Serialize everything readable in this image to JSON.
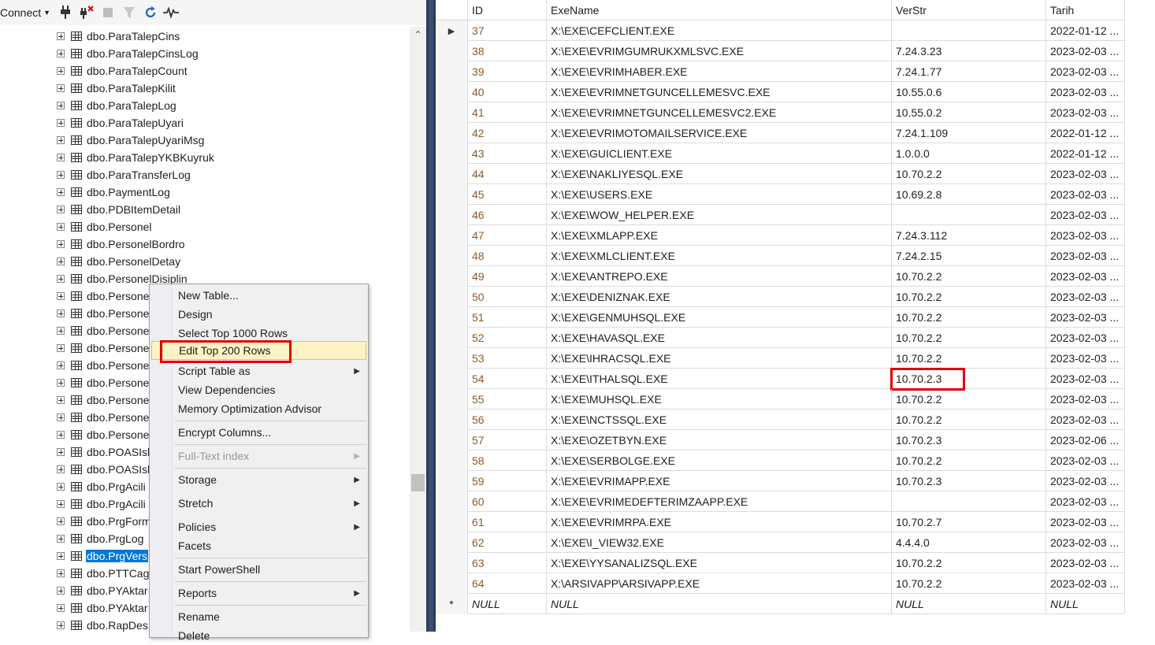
{
  "object_explorer": {
    "toolbar": {
      "connect_label": "Connect"
    },
    "items": [
      {
        "label": "dbo.ParaTalepCins"
      },
      {
        "label": "dbo.ParaTalepCinsLog"
      },
      {
        "label": "dbo.ParaTalepCount"
      },
      {
        "label": "dbo.ParaTalepKilit"
      },
      {
        "label": "dbo.ParaTalepLog"
      },
      {
        "label": "dbo.ParaTalepUyari"
      },
      {
        "label": "dbo.ParaTalepUyariMsg"
      },
      {
        "label": "dbo.ParaTalepYKBKuyruk"
      },
      {
        "label": "dbo.ParaTransferLog"
      },
      {
        "label": "dbo.PaymentLog"
      },
      {
        "label": "dbo.PDBItemDetail"
      },
      {
        "label": "dbo.Personel"
      },
      {
        "label": "dbo.PersonelBordro"
      },
      {
        "label": "dbo.PersonelDetay"
      },
      {
        "label": "dbo.PersonelDisiplin"
      },
      {
        "label": "dbo.Persone"
      },
      {
        "label": "dbo.Persone"
      },
      {
        "label": "dbo.Persone"
      },
      {
        "label": "dbo.Persone"
      },
      {
        "label": "dbo.Persone"
      },
      {
        "label": "dbo.Persone"
      },
      {
        "label": "dbo.Persone"
      },
      {
        "label": "dbo.Persone"
      },
      {
        "label": "dbo.Persone"
      },
      {
        "label": "dbo.POASIsl"
      },
      {
        "label": "dbo.POASIsl"
      },
      {
        "label": "dbo.PrgAcili"
      },
      {
        "label": "dbo.PrgAcili"
      },
      {
        "label": "dbo.PrgForm"
      },
      {
        "label": "dbo.PrgLog"
      },
      {
        "label": "dbo.PrgVers",
        "selected": true
      },
      {
        "label": "dbo.PTTCag"
      },
      {
        "label": "dbo.PYAktar"
      },
      {
        "label": "dbo.PYAktar"
      },
      {
        "label": "dbo.RapDes"
      }
    ]
  },
  "context_menu": {
    "items": [
      {
        "label": "New Table..."
      },
      {
        "label": "Design"
      },
      {
        "label": "Select Top 1000 Rows"
      },
      {
        "label": "Edit Top 200 Rows",
        "hovered": true
      },
      {
        "label": "Script Table as",
        "submenu": true
      },
      {
        "label": "View Dependencies"
      },
      {
        "label": "Memory Optimization Advisor"
      },
      {
        "label": "Encrypt Columns..."
      },
      {
        "label": "Full-Text index",
        "submenu": true,
        "disabled": true
      },
      {
        "label": "Storage",
        "submenu": true
      },
      {
        "label": "Stretch",
        "submenu": true
      },
      {
        "label": "Policies",
        "submenu": true
      },
      {
        "label": "Facets"
      },
      {
        "label": "Start PowerShell"
      },
      {
        "label": "Reports",
        "submenu": true
      },
      {
        "label": "Rename"
      },
      {
        "label": "Delete"
      }
    ]
  },
  "grid": {
    "headers": {
      "id": "ID",
      "exe": "ExeName",
      "ver": "VerStr",
      "tarih": "Tarih"
    },
    "rows": [
      {
        "id": "37",
        "exe": "X:\\EXE\\CEFCLIENT.EXE",
        "ver": "",
        "tarih": "2022-01-12 ..."
      },
      {
        "id": "38",
        "exe": "X:\\EXE\\EVRIMGUMRUKXMLSVC.EXE",
        "ver": "7.24.3.23",
        "tarih": "2023-02-03 ..."
      },
      {
        "id": "39",
        "exe": "X:\\EXE\\EVRIMHABER.EXE",
        "ver": "7.24.1.77",
        "tarih": "2023-02-03 ..."
      },
      {
        "id": "40",
        "exe": "X:\\EXE\\EVRIMNETGUNCELLEMESVC.EXE",
        "ver": "10.55.0.6",
        "tarih": "2023-02-03 ..."
      },
      {
        "id": "41",
        "exe": "X:\\EXE\\EVRIMNETGUNCELLEMESVC2.EXE",
        "ver": "10.55.0.2",
        "tarih": "2023-02-03 ..."
      },
      {
        "id": "42",
        "exe": "X:\\EXE\\EVRIMOTOMAILSERVICE.EXE",
        "ver": "7.24.1.109",
        "tarih": "2022-01-12 ..."
      },
      {
        "id": "43",
        "exe": "X:\\EXE\\GUICLIENT.EXE",
        "ver": "1.0.0.0",
        "tarih": "2022-01-12 ..."
      },
      {
        "id": "44",
        "exe": "X:\\EXE\\NAKLIYESQL.EXE",
        "ver": "10.70.2.2",
        "tarih": "2023-02-03 ..."
      },
      {
        "id": "45",
        "exe": "X:\\EXE\\USERS.EXE",
        "ver": "10.69.2.8",
        "tarih": "2023-02-03 ..."
      },
      {
        "id": "46",
        "exe": "X:\\EXE\\WOW_HELPER.EXE",
        "ver": "",
        "tarih": "2023-02-03 ..."
      },
      {
        "id": "47",
        "exe": "X:\\EXE\\XMLAPP.EXE",
        "ver": "7.24.3.112",
        "tarih": "2023-02-03 ..."
      },
      {
        "id": "48",
        "exe": "X:\\EXE\\XMLCLIENT.EXE",
        "ver": "7.24.2.15",
        "tarih": "2023-02-03 ..."
      },
      {
        "id": "49",
        "exe": "X:\\EXE\\ANTREPO.EXE",
        "ver": "10.70.2.2",
        "tarih": "2023-02-03 ..."
      },
      {
        "id": "50",
        "exe": "X:\\EXE\\DENIZNAK.EXE",
        "ver": "10.70.2.2",
        "tarih": "2023-02-03 ..."
      },
      {
        "id": "51",
        "exe": "X:\\EXE\\GENMUHSQL.EXE",
        "ver": "10.70.2.2",
        "tarih": "2023-02-03 ..."
      },
      {
        "id": "52",
        "exe": "X:\\EXE\\HAVASQL.EXE",
        "ver": "10.70.2.2",
        "tarih": "2023-02-03 ..."
      },
      {
        "id": "53",
        "exe": "X:\\EXE\\IHRACSQL.EXE",
        "ver": "10.70.2.2",
        "tarih": "2023-02-03 ..."
      },
      {
        "id": "54",
        "exe": "X:\\EXE\\ITHALSQL.EXE",
        "ver": "10.70.2.3",
        "tarih": "2023-02-03 ...",
        "highlight_ver": true
      },
      {
        "id": "55",
        "exe": "X:\\EXE\\MUHSQL.EXE",
        "ver": "10.70.2.2",
        "tarih": "2023-02-03 ..."
      },
      {
        "id": "56",
        "exe": "X:\\EXE\\NCTSSQL.EXE",
        "ver": "10.70.2.2",
        "tarih": "2023-02-03 ..."
      },
      {
        "id": "57",
        "exe": "X:\\EXE\\OZETBYN.EXE",
        "ver": "10.70.2.3",
        "tarih": "2023-02-06 ..."
      },
      {
        "id": "58",
        "exe": "X:\\EXE\\SERBOLGE.EXE",
        "ver": "10.70.2.2",
        "tarih": "2023-02-03 ..."
      },
      {
        "id": "59",
        "exe": "X:\\EXE\\EVRIMAPP.EXE",
        "ver": "10.70.2.3",
        "tarih": "2023-02-03 ..."
      },
      {
        "id": "60",
        "exe": "X:\\EXE\\EVRIMEDEFTERIMZAAPP.EXE",
        "ver": "",
        "tarih": "2023-02-03 ..."
      },
      {
        "id": "61",
        "exe": "X:\\EXE\\EVRIMRPA.EXE",
        "ver": "10.70.2.7",
        "tarih": "2023-02-03 ..."
      },
      {
        "id": "62",
        "exe": "X:\\EXE\\I_VIEW32.EXE",
        "ver": "4.4.4.0",
        "tarih": "2023-02-03 ..."
      },
      {
        "id": "63",
        "exe": "X:\\EXE\\YYSANALIZSQL.EXE",
        "ver": "10.70.2.2",
        "tarih": "2023-02-03 ..."
      },
      {
        "id": "64",
        "exe": "X:\\ARSIVAPP\\ARSIVAPP.EXE",
        "ver": "10.70.2.2",
        "tarih": "2023-02-03 ..."
      }
    ],
    "new_row": {
      "marker": "*",
      "id": "NULL",
      "exe": "NULL",
      "ver": "NULL",
      "tarih": "NULL"
    },
    "current_row_marker": "▶"
  },
  "colors": {
    "selection": "#0078d7",
    "highlight_box": "#e30000",
    "id_text": "#8b5a2b",
    "menu_hover": "#fcf3c4"
  }
}
